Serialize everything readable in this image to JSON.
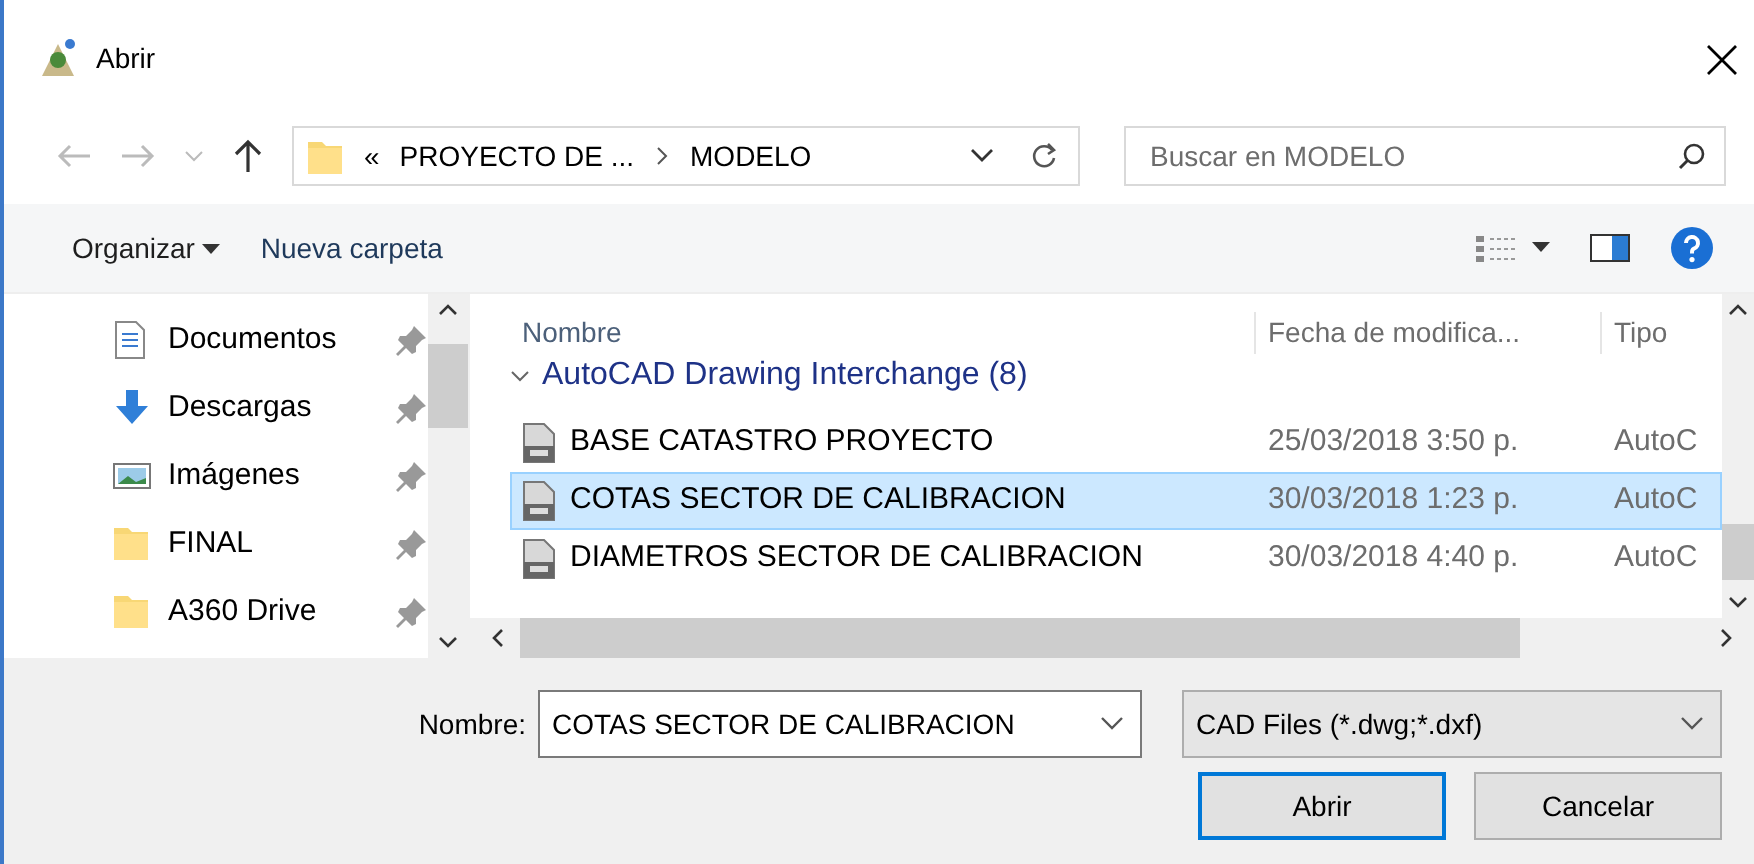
{
  "window": {
    "title": "Abrir"
  },
  "address": {
    "prefix": "«",
    "path": [
      {
        "label": "PROYECTO DE ..."
      },
      {
        "label": "MODELO"
      }
    ]
  },
  "search": {
    "placeholder": "Buscar en MODELO"
  },
  "toolbar": {
    "organize": "Organizar",
    "new_folder": "Nueva carpeta"
  },
  "sidebar": {
    "items": [
      {
        "label": "Documentos",
        "kind": "documents",
        "pinned": true
      },
      {
        "label": "Descargas",
        "kind": "downloads",
        "pinned": true
      },
      {
        "label": "Imágenes",
        "kind": "pictures",
        "pinned": true
      },
      {
        "label": "FINAL",
        "kind": "folder",
        "pinned": true
      },
      {
        "label": "A360 Drive",
        "kind": "folder",
        "pinned": true
      }
    ]
  },
  "file_list": {
    "columns": [
      "Nombre",
      "Fecha de modifica...",
      "Tipo"
    ],
    "group": {
      "label": "AutoCAD Drawing Interchange (8)",
      "expanded": true
    },
    "rows": [
      {
        "name": "BASE CATASTRO PROYECTO",
        "date": "25/03/2018 3:50 p.",
        "type": "AutoC",
        "selected": false
      },
      {
        "name": "COTAS SECTOR DE CALIBRACION",
        "date": "30/03/2018 1:23 p.",
        "type": "AutoC",
        "selected": true
      },
      {
        "name": "DIAMETROS SECTOR DE CALIBRACION",
        "date": "30/03/2018 4:40 p.",
        "type": "AutoC",
        "selected": false
      }
    ]
  },
  "file_name": {
    "label": "Nombre:",
    "value": "COTAS SECTOR DE CALIBRACION"
  },
  "file_type": {
    "value": "CAD Files (*.dwg;*.dxf)"
  },
  "buttons": [
    {
      "label": "Abrir",
      "kind": "primary"
    },
    {
      "label": "Cancelar",
      "kind": "secondary"
    }
  ]
}
